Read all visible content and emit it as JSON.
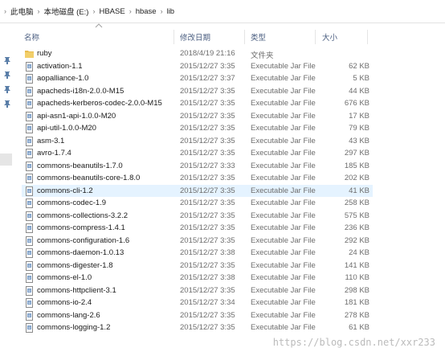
{
  "breadcrumb": {
    "separator": "›",
    "items": [
      "此电脑",
      "本地磁盘 (E:)",
      "HBASE",
      "hbase",
      "lib"
    ]
  },
  "columns": {
    "name": "名称",
    "date": "修改日期",
    "type": "类型",
    "size": "大小"
  },
  "files": [
    {
      "name": "ruby",
      "date": "2018/4/19 21:16",
      "type": "文件夹",
      "size": "",
      "icon": "folder-icon"
    },
    {
      "name": "activation-1.1",
      "date": "2015/12/27 3:35",
      "type": "Executable Jar File",
      "size": "62 KB",
      "icon": "jar-file-icon"
    },
    {
      "name": "aopalliance-1.0",
      "date": "2015/12/27 3:37",
      "type": "Executable Jar File",
      "size": "5 KB",
      "icon": "jar-file-icon"
    },
    {
      "name": "apacheds-i18n-2.0.0-M15",
      "date": "2015/12/27 3:35",
      "type": "Executable Jar File",
      "size": "44 KB",
      "icon": "jar-file-icon"
    },
    {
      "name": "apacheds-kerberos-codec-2.0.0-M15",
      "date": "2015/12/27 3:35",
      "type": "Executable Jar File",
      "size": "676 KB",
      "icon": "jar-file-icon"
    },
    {
      "name": "api-asn1-api-1.0.0-M20",
      "date": "2015/12/27 3:35",
      "type": "Executable Jar File",
      "size": "17 KB",
      "icon": "jar-file-icon"
    },
    {
      "name": "api-util-1.0.0-M20",
      "date": "2015/12/27 3:35",
      "type": "Executable Jar File",
      "size": "79 KB",
      "icon": "jar-file-icon"
    },
    {
      "name": "asm-3.1",
      "date": "2015/12/27 3:35",
      "type": "Executable Jar File",
      "size": "43 KB",
      "icon": "jar-file-icon"
    },
    {
      "name": "avro-1.7.4",
      "date": "2015/12/27 3:35",
      "type": "Executable Jar File",
      "size": "297 KB",
      "icon": "jar-file-icon"
    },
    {
      "name": "commons-beanutils-1.7.0",
      "date": "2015/12/27 3:33",
      "type": "Executable Jar File",
      "size": "185 KB",
      "icon": "jar-file-icon"
    },
    {
      "name": "commons-beanutils-core-1.8.0",
      "date": "2015/12/27 3:35",
      "type": "Executable Jar File",
      "size": "202 KB",
      "icon": "jar-file-icon"
    },
    {
      "name": "commons-cli-1.2",
      "date": "2015/12/27 3:35",
      "type": "Executable Jar File",
      "size": "41 KB",
      "icon": "jar-file-icon",
      "selected": true
    },
    {
      "name": "commons-codec-1.9",
      "date": "2015/12/27 3:35",
      "type": "Executable Jar File",
      "size": "258 KB",
      "icon": "jar-file-icon"
    },
    {
      "name": "commons-collections-3.2.2",
      "date": "2015/12/27 3:35",
      "type": "Executable Jar File",
      "size": "575 KB",
      "icon": "jar-file-icon"
    },
    {
      "name": "commons-compress-1.4.1",
      "date": "2015/12/27 3:35",
      "type": "Executable Jar File",
      "size": "236 KB",
      "icon": "jar-file-icon"
    },
    {
      "name": "commons-configuration-1.6",
      "date": "2015/12/27 3:35",
      "type": "Executable Jar File",
      "size": "292 KB",
      "icon": "jar-file-icon"
    },
    {
      "name": "commons-daemon-1.0.13",
      "date": "2015/12/27 3:38",
      "type": "Executable Jar File",
      "size": "24 KB",
      "icon": "jar-file-icon"
    },
    {
      "name": "commons-digester-1.8",
      "date": "2015/12/27 3:35",
      "type": "Executable Jar File",
      "size": "141 KB",
      "icon": "jar-file-icon"
    },
    {
      "name": "commons-el-1.0",
      "date": "2015/12/27 3:38",
      "type": "Executable Jar File",
      "size": "110 KB",
      "icon": "jar-file-icon"
    },
    {
      "name": "commons-httpclient-3.1",
      "date": "2015/12/27 3:35",
      "type": "Executable Jar File",
      "size": "298 KB",
      "icon": "jar-file-icon"
    },
    {
      "name": "commons-io-2.4",
      "date": "2015/12/27 3:34",
      "type": "Executable Jar File",
      "size": "181 KB",
      "icon": "jar-file-icon"
    },
    {
      "name": "commons-lang-2.6",
      "date": "2015/12/27 3:35",
      "type": "Executable Jar File",
      "size": "278 KB",
      "icon": "jar-file-icon"
    },
    {
      "name": "commons-logging-1.2",
      "date": "2015/12/27 3:35",
      "type": "Executable Jar File",
      "size": "61 KB",
      "icon": "jar-file-icon"
    }
  ],
  "watermark": "https://blog.csdn.net/xxr233",
  "colors": {
    "selected_row": "#e5f3ff",
    "header_text": "#4d6082",
    "folder": "#e8bc4e"
  }
}
